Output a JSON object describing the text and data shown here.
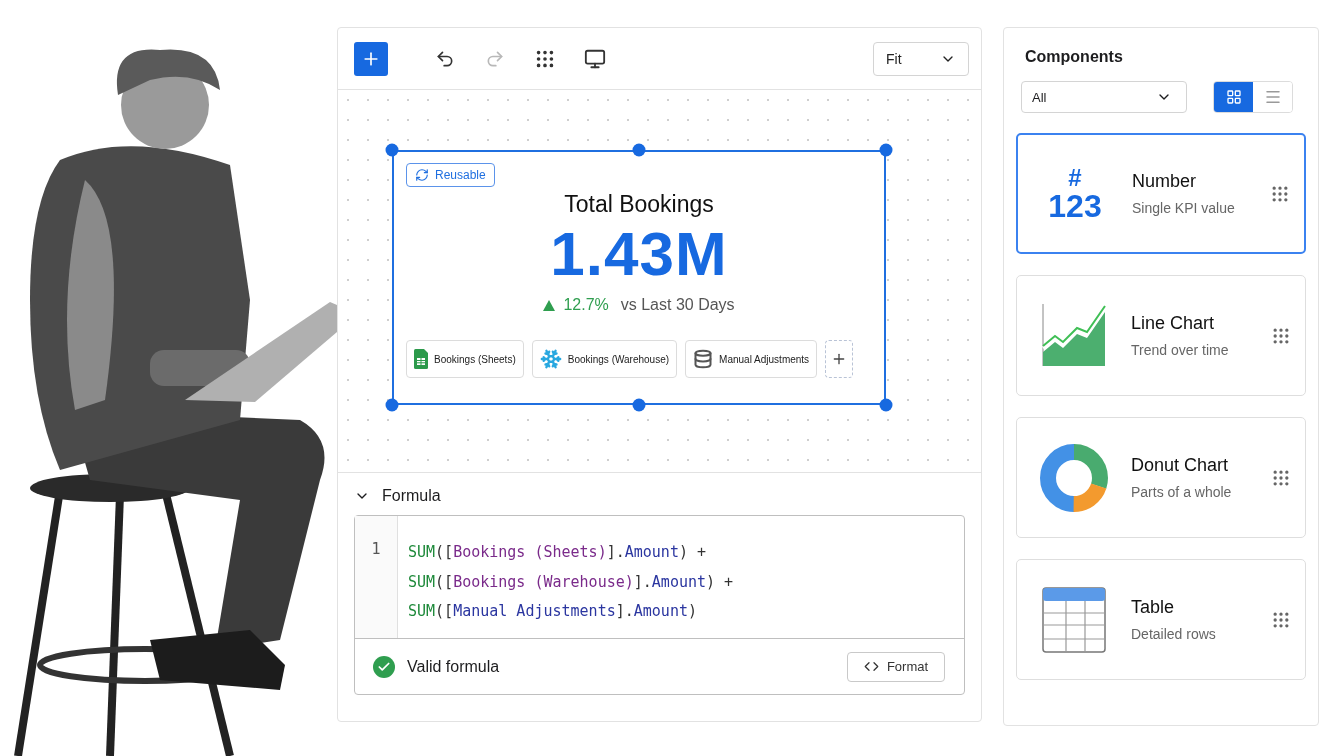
{
  "toolbar": {
    "buttons": [
      {
        "kind": "add",
        "disabled": false
      },
      {
        "kind": "undo",
        "disabled": false
      },
      {
        "kind": "redo",
        "disabled": true
      },
      {
        "kind": "grid",
        "disabled": false
      },
      {
        "kind": "preview",
        "disabled": false
      }
    ],
    "zoom_select": {
      "value": "Fit"
    }
  },
  "widget": {
    "selected": true,
    "badge": "Reusable",
    "title": "Total Bookings",
    "value": "1.43M",
    "change": {
      "up": true,
      "text": "12.7%"
    },
    "comparison": "vs Last 30 Days",
    "sources": [
      {
        "kind": "sheets",
        "label": "Bookings (Sheets)"
      },
      {
        "kind": "warehouse",
        "label": "Bookings (Warehouse)"
      },
      {
        "kind": "database",
        "label": "Manual Adjustments"
      }
    ]
  },
  "formula": {
    "expanded": true,
    "title": "Formula",
    "line_number": "1",
    "lines": [
      [
        {
          "kind": "fn",
          "text": "SUM"
        },
        {
          "kind": "punct",
          "text": "(["
        },
        {
          "kind": "source",
          "text": "Bookings (Sheets)"
        },
        {
          "kind": "punct",
          "text": "]."
        },
        {
          "kind": "field",
          "text": "Amount"
        },
        {
          "kind": "punct",
          "text": ") +"
        }
      ],
      [
        {
          "kind": "fn",
          "text": "SUM"
        },
        {
          "kind": "punct",
          "text": "(["
        },
        {
          "kind": "source",
          "text": "Bookings (Warehouse)"
        },
        {
          "kind": "punct",
          "text": "]."
        },
        {
          "kind": "field",
          "text": "Amount"
        },
        {
          "kind": "punct",
          "text": ") +"
        }
      ],
      [
        {
          "kind": "fn",
          "text": "SUM"
        },
        {
          "kind": "punct",
          "text": "(["
        },
        {
          "kind": "field",
          "text": "Manual Adjustments"
        },
        {
          "kind": "punct",
          "text": "]."
        },
        {
          "kind": "field",
          "text": "Amount"
        },
        {
          "kind": "punct",
          "text": ")"
        }
      ]
    ],
    "status": {
      "valid": true,
      "text": "Valid formula"
    },
    "format_button": "Format"
  },
  "components": {
    "title": "Components",
    "filter": {
      "value": "All"
    },
    "view_toggle": [
      {
        "kind": "grid",
        "selected": true
      },
      {
        "kind": "list",
        "selected": false
      }
    ],
    "items": [
      {
        "kind": "number",
        "glyph": "#",
        "glyph_value": "123",
        "title": "Number",
        "subtitle": "Single KPI value",
        "selected": true
      },
      {
        "kind": "line",
        "title": "Line Chart",
        "subtitle": "Trend over time",
        "selected": false
      },
      {
        "kind": "donut",
        "title": "Donut Chart",
        "subtitle": "Parts of a whole",
        "selected": false
      },
      {
        "kind": "table",
        "title": "Table",
        "subtitle": "Detailed rows",
        "selected": false
      }
    ]
  }
}
